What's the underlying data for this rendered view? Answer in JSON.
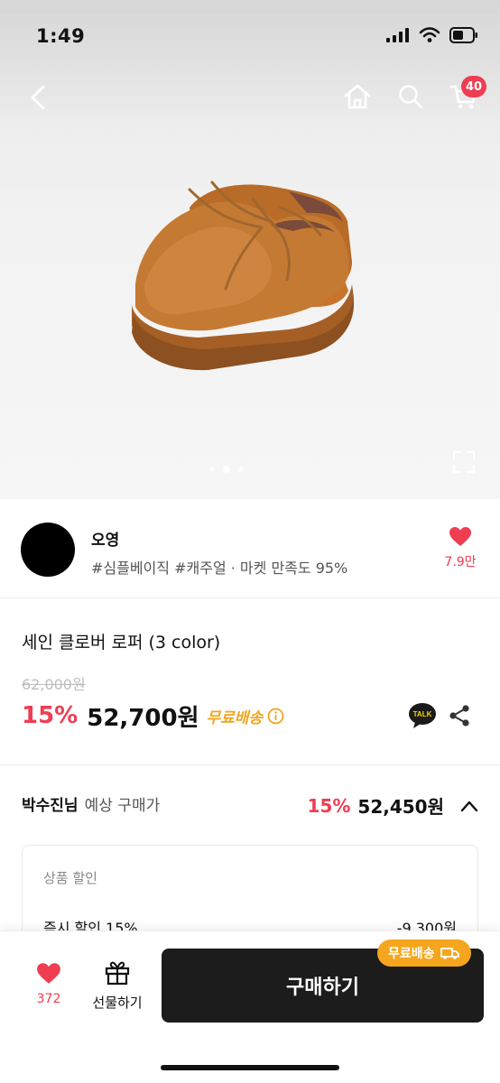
{
  "status_bar": {
    "time": "1:49"
  },
  "header": {
    "cart_count": "40"
  },
  "seller": {
    "name": "오영",
    "tags": "#심플베이직 #캐주얼 · 마켓 만족도 95%",
    "likes": "7.9만"
  },
  "product": {
    "title": "세인 클로버 로퍼 (3 color)",
    "original_price": "62,000원",
    "discount_rate": "15%",
    "price": "52,700원",
    "shipping_label": "무료배송",
    "talk_label": "TALK"
  },
  "expected": {
    "buyer": "박수진님",
    "label": "예상 구매가",
    "rate": "15%",
    "price": "52,450원"
  },
  "discount_detail": {
    "header": "상품 할인",
    "items": [
      {
        "label": "즉시 할인 15%",
        "value": "-9,300원"
      }
    ]
  },
  "bottom_bar": {
    "wish_count": "372",
    "gift_label": "선물하기",
    "buy_label": "구매하기",
    "shipping_badge": "무료배송"
  },
  "colors": {
    "accent": "#ef3d52",
    "shipping": "#f1a51d",
    "buy_button": "#1c1c1c"
  },
  "icons": [
    "back-icon",
    "home-icon",
    "search-icon",
    "cart-icon",
    "expand-icon",
    "heart-icon",
    "info-icon",
    "kakao-talk-icon",
    "share-icon",
    "chevron-up-icon",
    "gift-icon",
    "truck-icon"
  ]
}
